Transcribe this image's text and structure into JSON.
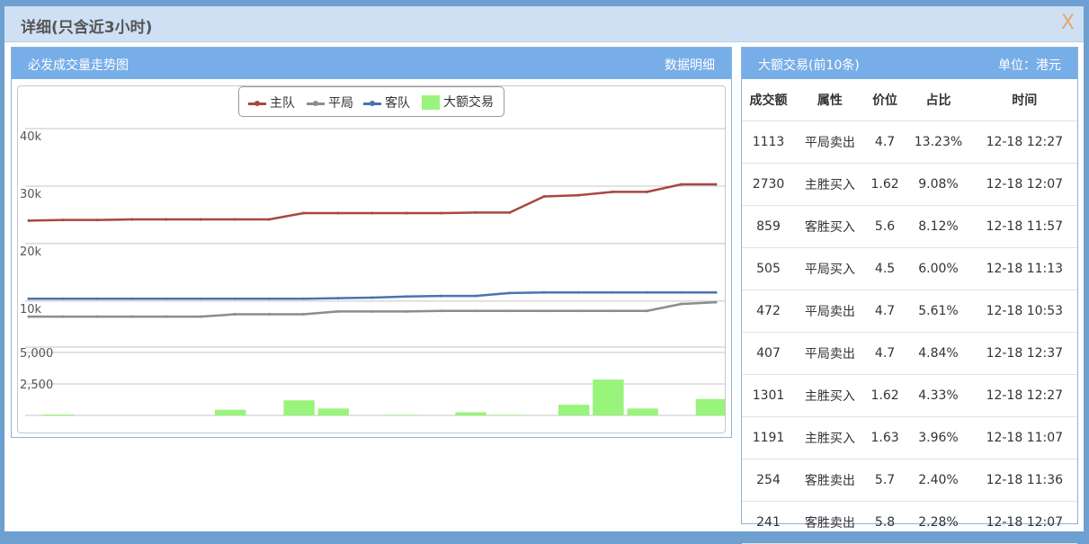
{
  "window": {
    "title": "详细(只含近3小时)",
    "close_label": "X"
  },
  "chart_panel": {
    "title": "必发成交量走势图",
    "detail_link": "数据明细"
  },
  "legend": [
    {
      "label": "主队",
      "color": "#a84740",
      "kind": "line"
    },
    {
      "label": "平局",
      "color": "#8c8c8c",
      "kind": "line"
    },
    {
      "label": "客队",
      "color": "#4a73b0",
      "kind": "line"
    },
    {
      "label": "大额交易",
      "color": "#99f47b",
      "kind": "bar"
    }
  ],
  "chart_data": {
    "type": "line",
    "upper_axis": {
      "tick_labels": [
        "40k",
        "30k",
        "20k",
        "10k"
      ],
      "ticks": [
        40000,
        30000,
        20000,
        10000
      ],
      "ylim": [
        2000,
        40000
      ]
    },
    "lower_axis": {
      "tick_labels": [
        "5,000",
        "2,500"
      ],
      "ticks": [
        5000,
        2500
      ],
      "ylim": [
        0,
        5000
      ]
    },
    "grid": true,
    "legend_position": "top-center",
    "series": [
      {
        "name": "主队",
        "color": "#a84740",
        "type": "line",
        "values": [
          24000,
          24100,
          24100,
          24200,
          24200,
          24200,
          24200,
          24200,
          25300,
          25300,
          25300,
          25300,
          25300,
          25400,
          25400,
          28200,
          28400,
          29000,
          29000,
          30300,
          30300
        ]
      },
      {
        "name": "平局",
        "color": "#8c8c8c",
        "type": "line",
        "values": [
          7300,
          7300,
          7300,
          7300,
          7300,
          7300,
          7700,
          7700,
          7700,
          8200,
          8200,
          8200,
          8300,
          8300,
          8300,
          8300,
          8300,
          8300,
          8300,
          9500,
          9800
        ]
      },
      {
        "name": "客队",
        "color": "#4a73b0",
        "type": "line",
        "values": [
          10400,
          10400,
          10400,
          10400,
          10400,
          10400,
          10400,
          10400,
          10400,
          10500,
          10600,
          10800,
          10900,
          10900,
          11400,
          11500,
          11500,
          11500,
          11500,
          11500,
          11500
        ]
      },
      {
        "name": "大额交易",
        "color": "#99f47b",
        "type": "bar",
        "values": [
          80,
          0,
          0,
          0,
          0,
          450,
          0,
          1200,
          550,
          0,
          50,
          0,
          250,
          50,
          0,
          850,
          2850,
          550,
          0,
          1300,
          450
        ]
      }
    ]
  },
  "table_panel": {
    "title": "大额交易(前10条)",
    "unit": "单位：港元"
  },
  "table": {
    "headers": [
      "成交额",
      "属性",
      "价位",
      "占比",
      "时间"
    ],
    "rows": [
      [
        "1113",
        "平局卖出",
        "4.7",
        "13.23%",
        "12-18 12:27"
      ],
      [
        "2730",
        "主胜买入",
        "1.62",
        "9.08%",
        "12-18 12:07"
      ],
      [
        "859",
        "客胜买入",
        "5.6",
        "8.12%",
        "12-18 11:57"
      ],
      [
        "505",
        "平局买入",
        "4.5",
        "6.00%",
        "12-18 11:13"
      ],
      [
        "472",
        "平局卖出",
        "4.7",
        "5.61%",
        "12-18 10:53"
      ],
      [
        "407",
        "平局卖出",
        "4.7",
        "4.84%",
        "12-18 12:37"
      ],
      [
        "1301",
        "主胜买入",
        "1.62",
        "4.33%",
        "12-18 12:27"
      ],
      [
        "1191",
        "主胜买入",
        "1.63",
        "3.96%",
        "12-18 11:07"
      ],
      [
        "254",
        "客胜卖出",
        "5.7",
        "2.40%",
        "12-18 11:36"
      ],
      [
        "241",
        "客胜卖出",
        "5.8",
        "2.28%",
        "12-18 12:07"
      ]
    ]
  }
}
